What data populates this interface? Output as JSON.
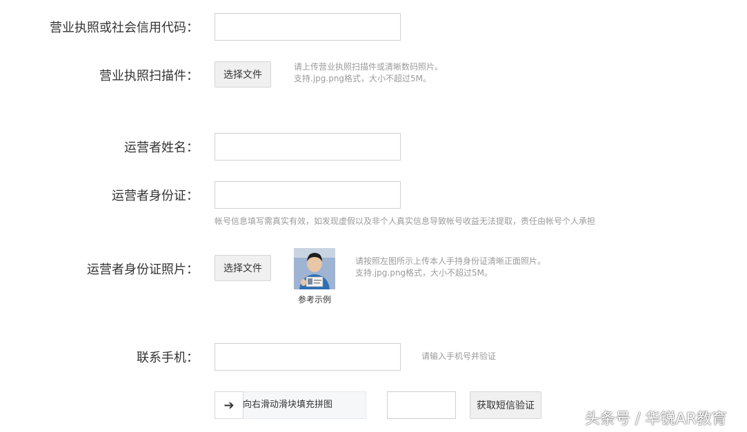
{
  "form": {
    "license_code": {
      "label": "营业执照或社会信用代码：",
      "value": ""
    },
    "license_scan": {
      "label": "营业执照扫描件：",
      "button": "选择文件",
      "hint_line1": "请上传营业执照扫描件或清晰数码照片。",
      "hint_line2": "支持.jpg.png格式，大小不超过5M。"
    },
    "operator_name": {
      "label": "运营者姓名：",
      "value": ""
    },
    "operator_id": {
      "label": "运营者身份证：",
      "value": "",
      "note": "帐号信息填写需真实有效，如发现虚假以及非个人真实信息导致帐号收益无法提取，责任由帐号个人承担"
    },
    "operator_id_photo": {
      "label": "运营者身份证照片：",
      "button": "选择文件",
      "example_caption": "参考示例",
      "hint_line1": "请按照左图所示上传本人手持身份证清晰正面照片。",
      "hint_line2": "支持.jpg.png格式，大小不超过5M。"
    },
    "phone": {
      "label": "联系手机：",
      "value": "",
      "hint": "请输入手机号并验证"
    },
    "captcha": {
      "slider_arrow": "➔",
      "slider_text": "向右滑动滑块填充拼图",
      "code_value": "",
      "sms_button": "获取短信验证"
    }
  },
  "watermark": "头条号 / 华锐AR教育"
}
